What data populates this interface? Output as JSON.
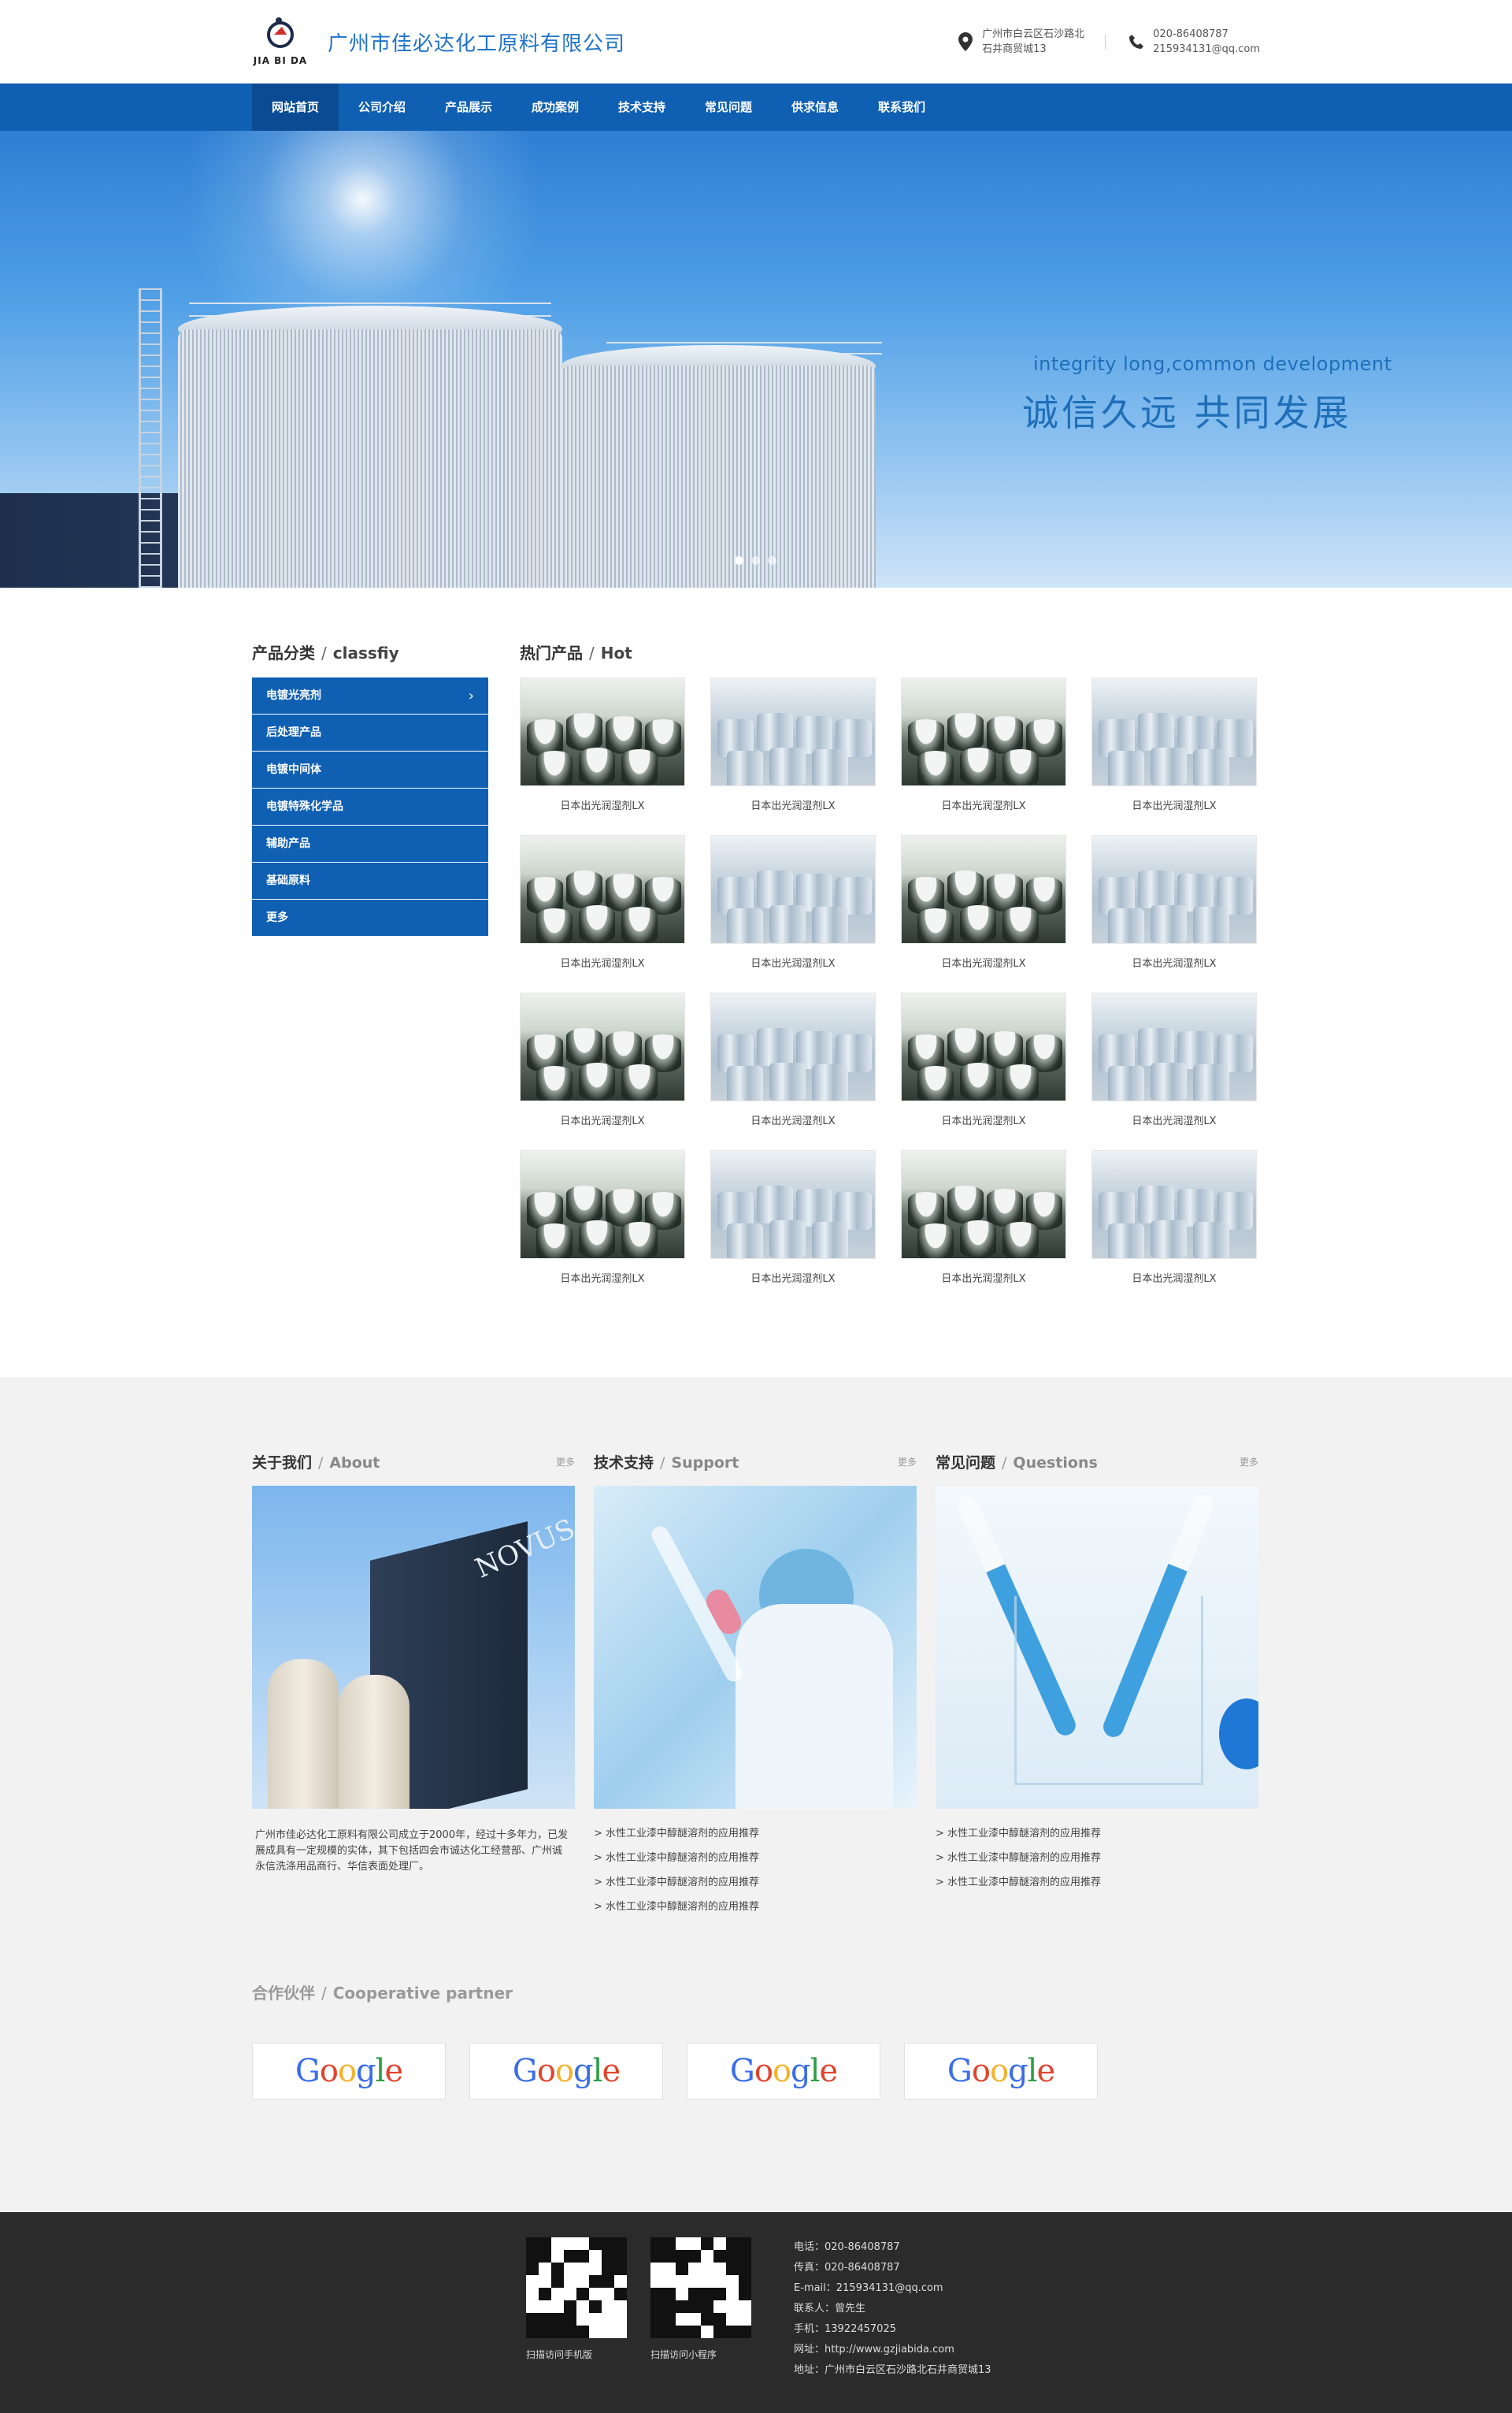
{
  "header": {
    "logo_text": "JIA BI DA",
    "company_name": "广州市佳必达化工原料有限公司",
    "address_line1": "广州市白云区石沙路北",
    "address_line2": "石井商贸城13",
    "phone": "020-86408787",
    "email": "215934131@qq.com"
  },
  "nav": {
    "items": [
      "网站首页",
      "公司介绍",
      "产品展示",
      "成功案例",
      "技术支持",
      "常见问题",
      "供求信息",
      "联系我们"
    ]
  },
  "banner": {
    "slogan_en": "integrity long,common development",
    "slogan_cn": "诚信久远  共同发展",
    "slide_count": 3,
    "active_slide": 1
  },
  "classify": {
    "title_cn": "产品分类",
    "title_en": "classfiy",
    "items": [
      "电镀光亮剂",
      "后处理产品",
      "电镀中间体",
      "电镀特殊化学品",
      "辅助产品",
      "基础原料",
      "更多"
    ]
  },
  "hot": {
    "title_cn": "热门产品",
    "title_en": "Hot",
    "products": [
      "日本出光润湿剂LX",
      "日本出光润湿剂LX",
      "日本出光润湿剂LX",
      "日本出光润湿剂LX",
      "日本出光润湿剂LX",
      "日本出光润湿剂LX",
      "日本出光润湿剂LX",
      "日本出光润湿剂LX",
      "日本出光润湿剂LX",
      "日本出光润湿剂LX",
      "日本出光润湿剂LX",
      "日本出光润湿剂LX",
      "日本出光润湿剂LX",
      "日本出光润湿剂LX",
      "日本出光润湿剂LX",
      "日本出光润湿剂LX"
    ]
  },
  "about": {
    "title_cn": "关于我们",
    "title_en": "About",
    "more": "更多",
    "image_text": "NOVUS",
    "text": "广州市佳必达化工原料有限公司成立于2000年，经过十多年力，已发展成具有一定规模的实体，其下包括四会市诚达化工经营部、广州诚永信洗涤用品商行、华信表面处理厂。"
  },
  "support": {
    "title_cn": "技术支持",
    "title_en": "Support",
    "more": "更多",
    "items": [
      "> 水性工业漆中醇醚溶剂的应用推荐",
      "> 水性工业漆中醇醚溶剂的应用推荐",
      "> 水性工业漆中醇醚溶剂的应用推荐",
      "> 水性工业漆中醇醚溶剂的应用推荐"
    ]
  },
  "questions": {
    "title_cn": "常见问题",
    "title_en": "Questions",
    "more": "更多",
    "items": [
      "> 水性工业漆中醇醚溶剂的应用推荐",
      "> 水性工业漆中醇醚溶剂的应用推荐",
      "> 水性工业漆中醇醚溶剂的应用推荐"
    ]
  },
  "partners": {
    "title_cn": "合作伙伴",
    "title_en": "Cooperative partner",
    "logos": [
      "Google",
      "Google",
      "Google",
      "Google"
    ],
    "logo_colors": [
      "#3a6ee8",
      "#e0442e",
      "#f2b32a",
      "#3a6ee8",
      "#2e9e48",
      "#e0442e"
    ]
  },
  "footer": {
    "qr1_caption": "扫描访问手机版",
    "qr2_caption": "扫描访问小程序",
    "lines": [
      "电话：020-86408787",
      "传真：020-86408787",
      "E-mail：215934131@qq.com",
      "联系人：曾先生",
      "手机：13922457025",
      "网址：http://www.gzjiabida.com",
      "地址：广州市白云区石沙路北石井商贸城13"
    ]
  },
  "colors": {
    "brand_blue": "#0f5fb3",
    "nav_active": "#0a4b94",
    "company_name": "#1f73c9",
    "footer_bg": "#2b2b2b",
    "info_bg": "#f2f2f2"
  }
}
